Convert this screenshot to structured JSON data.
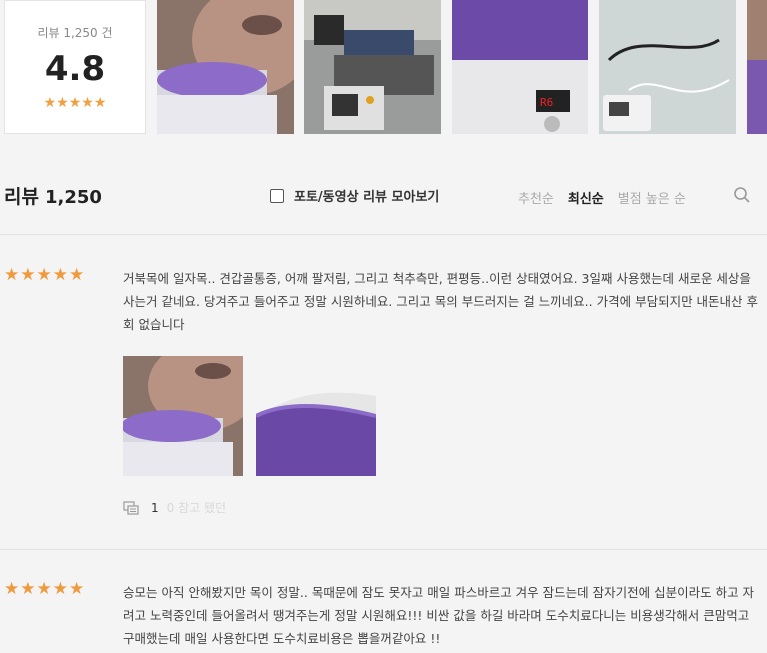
{
  "summary": {
    "review_label": "리뷰 1,250 건",
    "score": "4.8",
    "stars": "★★★★★"
  },
  "gallery": {
    "thumbnails": [
      "neck-massage-photo",
      "device-in-use-photo",
      "purple-cushion-photo",
      "controller-display-photo",
      "cable-controller-photo",
      "partial-photo"
    ]
  },
  "header": {
    "title": "리뷰",
    "count": "1,250",
    "photo_filter_label": "포토/동영상 리뷰 모아보기",
    "sort_options": [
      "추천순",
      "최신순",
      "별점 높은 순"
    ],
    "active_sort": "최신순"
  },
  "reviews": [
    {
      "stars": "★★★★★",
      "text": "거북목에 일자목.. 견갑골통증, 어깨 팔저림, 그리고 척추측만, 편평등..이런 상태였어요. 3일째 사용했는데 새로운 세상을 사는거 같네요. 당겨주고 들어주고 정말 시원하네요. 그리고 목의 부드러지는 걸 느끼네요.. 가격에 부담되지만 내돈내산 후회 없습니다",
      "comment_count": "1",
      "helpful_label": "0 참고 됐던"
    },
    {
      "stars": "★★★★★",
      "text": "승모는 아직 안해봤지만 목이 정말.. 목때문에 잠도 못자고 매일 파스바르고 겨우 잠드는데 잠자기전에 십분이라도 하고 자려고 노력중인데 들어올려서 땡겨주는게 정말 시원해요!!! 비싼 값을 하길 바라며 도수치료다니는 비용생각해서 큰맘먹고 구매했는데 매일 사용한다면 도수치료비용은 뽑을꺼같아요 !!"
    }
  ],
  "colors": {
    "star": "#f09a3e",
    "background": "#f4f4f4",
    "accent_purple": "#6b3fa8"
  }
}
